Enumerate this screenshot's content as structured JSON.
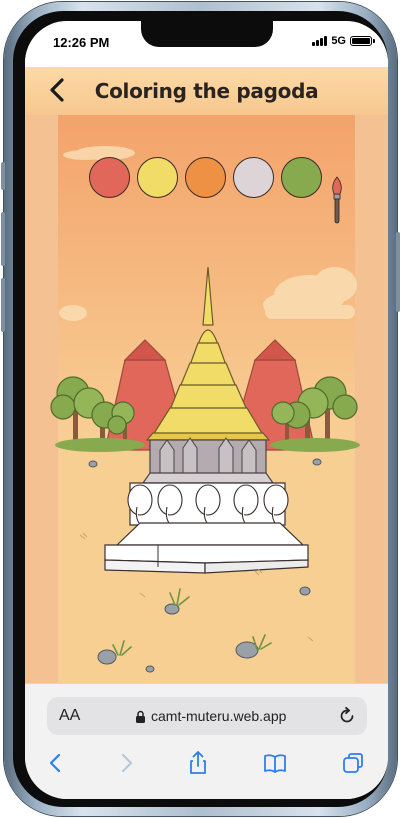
{
  "status_bar": {
    "time": "12:26 PM",
    "network": "5G"
  },
  "header": {
    "title": "Coloring the pagoda",
    "back_icon": "chevron-left-icon"
  },
  "palette": {
    "colors": [
      {
        "name": "red",
        "hex": "#e0675a"
      },
      {
        "name": "yellow",
        "hex": "#f1dc68"
      },
      {
        "name": "orange",
        "hex": "#ee9145"
      },
      {
        "name": "light-gray",
        "hex": "#dcd4d6"
      },
      {
        "name": "green",
        "hex": "#86aa4d"
      }
    ],
    "tool_icon": "paintbrush-icon"
  },
  "scene": {
    "pagoda_spire_color": "#f1dc68",
    "pagoda_body_color": "#b3abaf",
    "base_color": "#ffffff",
    "roof_color": "#e0675a",
    "tree_color": "#86aa4d"
  },
  "browser": {
    "text_size_label": "AA",
    "url": "camt-muteru.web.app",
    "lock_icon": "lock-icon",
    "reload_icon": "reload-icon",
    "toolbar_icons": [
      "back-icon",
      "forward-icon",
      "share-icon",
      "bookmarks-icon",
      "tabs-icon"
    ]
  }
}
